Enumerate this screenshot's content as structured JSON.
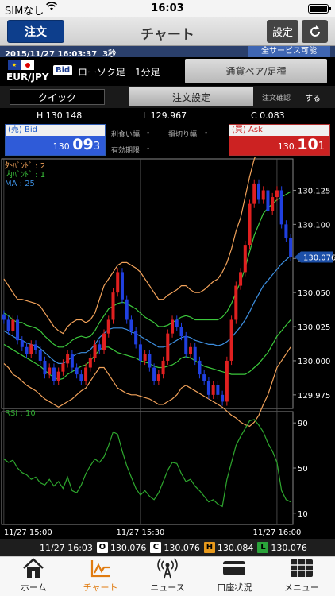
{
  "status_bar": {
    "carrier": "SIMなし",
    "time": "16:03"
  },
  "header": {
    "order_button": "注文",
    "title": "チャート",
    "settings_button": "設定",
    "refresh_icon": "refresh-icon"
  },
  "info_strip": {
    "timestamp": "2015/11/27 16:03:37",
    "age": "3秒",
    "service_status": "全サービス可能"
  },
  "pair": {
    "name": "EUR/JPY",
    "rate_type": "Bid",
    "chart_type": "ローソク足",
    "interval": "1分足",
    "pair_button": "通貨ペア/足種"
  },
  "quick_row": {
    "quick_button": "クイック",
    "order_settings_button": "注文設定",
    "confirm_label": "注文確認",
    "confirm_value": "する"
  },
  "hlc": {
    "high": "H  130.148",
    "low": "L  129.967",
    "change": "C  0.083"
  },
  "bid": {
    "label": "(売) Bid",
    "price_small": "130.",
    "price_big": "09",
    "price_tail": "3"
  },
  "ask": {
    "label": "(買) Ask",
    "price_small": "130.",
    "price_big": "10",
    "price_tail": "1"
  },
  "mid_fields": {
    "take_profit": "利食い幅",
    "stop_loss": "損切り幅",
    "expiry": "有効期限",
    "dash": "-"
  },
  "legend": {
    "outer_band": "外ﾊﾞﾝﾄﾞ : 2",
    "inner_band": "内ﾊﾞﾝﾄﾞ : 1",
    "ma": "MA : 25",
    "rsi": "RSI : 10"
  },
  "colors": {
    "outer_band": "#f2a25a",
    "inner_band": "#3cc83c",
    "ma": "#3d8fe0",
    "rsi": "#2ea82e",
    "bull": "#e02020",
    "bear": "#2040e0",
    "bid": "#2f5bd8",
    "ask": "#cc2222",
    "tab_active": "#e07b10"
  },
  "chart_data": [
    {
      "type": "candlestick",
      "title": "",
      "y_ticks": [
        "130.125",
        "130.100",
        "130.075",
        "130.050",
        "130.025",
        "130.000",
        "129.975"
      ],
      "current_price_label": "130.076",
      "current_price": 130.076,
      "ylim": [
        129.965,
        130.148
      ],
      "x_ticks": [
        "11/27 15:00",
        "11/27 15:30",
        "11/27 16:00"
      ],
      "x_tick_index": [
        0,
        30,
        60
      ],
      "bar_count": 64,
      "close": [
        130.03,
        130.022,
        130.03,
        130.015,
        130.01,
        130.005,
        130.012,
        130.008,
        130.0,
        129.99,
        129.995,
        129.985,
        129.992,
        129.998,
        130.005,
        129.995,
        129.99,
        129.985,
        129.995,
        130.002,
        130.012,
        130.008,
        130.02,
        130.03,
        130.05,
        130.065,
        130.045,
        130.03,
        130.022,
        130.012,
        130.0,
        130.005,
        129.995,
        129.985,
        129.99,
        130.0,
        130.02,
        130.03,
        130.025,
        130.018,
        130.005,
        130.01,
        130.0,
        129.99,
        129.985,
        129.975,
        129.982,
        129.975,
        129.97,
        130.0,
        130.03,
        130.055,
        130.065,
        130.085,
        130.115,
        130.13,
        130.118,
        130.125,
        130.11,
        130.12,
        130.125,
        130.1,
        130.09,
        130.076
      ],
      "series": [
        {
          "name": "外ﾊﾞﾝﾄﾞ : 2",
          "values": [
            130.06,
            130.055,
            130.05,
            130.045,
            130.045,
            130.044,
            130.043,
            130.042,
            130.04,
            130.035,
            130.03,
            130.025,
            130.022,
            130.02,
            130.025,
            130.028,
            130.03,
            130.03,
            130.028,
            130.03,
            130.035,
            130.045,
            130.055,
            130.06,
            130.065,
            130.07,
            130.072,
            130.072,
            130.07,
            130.068,
            130.065,
            130.06,
            130.055,
            130.05,
            130.045,
            130.045,
            130.048,
            130.05,
            130.052,
            130.055,
            130.055,
            130.052,
            130.05,
            130.05,
            130.052,
            130.055,
            130.058,
            130.06,
            130.065,
            130.072,
            130.082,
            130.095,
            130.105,
            130.12,
            130.135,
            130.148,
            130.155,
            130.16,
            130.165,
            130.165,
            130.165,
            130.162,
            130.16,
            130.16
          ]
        },
        {
          "name": "外ﾊﾞﾝﾄﾞ : 2 (lower)",
          "values": [
            129.998,
            129.995,
            129.99,
            129.988,
            129.985,
            129.982,
            129.98,
            129.978,
            129.975,
            129.972,
            129.97,
            129.968,
            129.966,
            129.968,
            129.97,
            129.972,
            129.975,
            129.978,
            129.98,
            129.985,
            129.99,
            129.995,
            129.995,
            129.99,
            129.985,
            129.98,
            129.978,
            129.976,
            129.975,
            129.975,
            129.974,
            129.973,
            129.972,
            129.97,
            129.968,
            129.968,
            129.97,
            129.972,
            129.975,
            129.98,
            129.982,
            129.98,
            129.978,
            129.976,
            129.974,
            129.972,
            129.97,
            129.968,
            129.966,
            129.963,
            129.96,
            129.958,
            129.955,
            129.953,
            129.952,
            129.955,
            129.96,
            129.968,
            129.975,
            129.985,
            129.995,
            130.0,
            130.005,
            130.01
          ]
        },
        {
          "name": "内ﾊﾞﾝﾄﾞ : 1",
          "values": [
            130.035,
            130.033,
            130.03,
            130.028,
            130.028,
            130.026,
            130.025,
            130.024,
            130.022,
            130.018,
            130.015,
            130.012,
            130.01,
            130.01,
            130.012,
            130.015,
            130.017,
            130.018,
            130.017,
            130.018,
            130.022,
            130.028,
            130.033,
            130.038,
            130.04,
            130.042,
            130.043,
            130.042,
            130.04,
            130.038,
            130.035,
            130.032,
            130.03,
            130.028,
            130.025,
            130.025,
            130.026,
            130.028,
            130.03,
            130.032,
            130.033,
            130.032,
            130.03,
            130.03,
            130.03,
            130.03,
            130.03,
            130.03,
            130.032,
            130.036,
            130.042,
            130.05,
            130.058,
            130.068,
            130.08,
            130.092,
            130.1,
            130.108,
            130.112,
            130.115,
            130.118,
            130.12,
            130.122,
            130.124
          ]
        },
        {
          "name": "内ﾊﾞﾝﾄﾞ : 1 (lower)",
          "values": [
            130.012,
            130.01,
            130.008,
            130.006,
            130.004,
            130.002,
            130.0,
            129.998,
            129.996,
            129.993,
            129.99,
            129.988,
            129.986,
            129.987,
            129.99,
            129.992,
            129.994,
            129.996,
            129.997,
            130.0,
            130.004,
            130.008,
            130.01,
            130.01,
            130.008,
            130.006,
            130.005,
            130.004,
            130.003,
            130.002,
            130.0,
            129.999,
            129.998,
            129.996,
            129.995,
            129.995,
            129.996,
            129.997,
            129.999,
            130.002,
            130.003,
            130.002,
            130.0,
            129.998,
            129.996,
            129.995,
            129.994,
            129.993,
            129.992,
            129.991,
            129.99,
            129.99,
            129.99,
            129.99,
            129.992,
            129.995,
            129.998,
            130.002,
            130.006,
            130.012,
            130.018,
            130.022,
            130.026,
            130.03
          ]
        },
        {
          "name": "MA : 25",
          "values": [
            130.022,
            130.02,
            130.018,
            130.016,
            130.015,
            130.013,
            130.012,
            130.011,
            130.009,
            130.006,
            130.003,
            130.0,
            129.998,
            129.998,
            130.0,
            130.003,
            130.005,
            130.006,
            130.006,
            130.008,
            130.012,
            130.017,
            130.02,
            130.023,
            130.024,
            130.024,
            130.024,
            130.023,
            130.021,
            130.02,
            130.018,
            130.016,
            130.014,
            130.012,
            130.01,
            130.01,
            130.011,
            130.013,
            130.015,
            130.017,
            130.018,
            130.017,
            130.015,
            130.014,
            130.013,
            130.012,
            130.012,
            130.011,
            130.012,
            130.014,
            130.017,
            130.021,
            130.025,
            130.03,
            130.036,
            130.043,
            130.049,
            130.055,
            130.059,
            130.063,
            130.067,
            130.071,
            130.074,
            130.077
          ]
        }
      ]
    },
    {
      "type": "line",
      "title": "",
      "y_ticks": [
        "90",
        "50",
        "10"
      ],
      "ylim": [
        0,
        100
      ],
      "series": [
        {
          "name": "RSI : 10",
          "values": [
            58,
            55,
            57,
            50,
            46,
            44,
            40,
            42,
            37,
            35,
            40,
            34,
            38,
            32,
            42,
            30,
            28,
            35,
            45,
            52,
            58,
            55,
            60,
            70,
            82,
            80,
            65,
            52,
            42,
            32,
            26,
            30,
            25,
            22,
            28,
            38,
            48,
            55,
            54,
            45,
            38,
            40,
            34,
            30,
            25,
            20,
            22,
            18,
            16,
            40,
            55,
            70,
            78,
            85,
            92,
            93,
            88,
            82,
            72,
            65,
            55,
            30,
            22,
            20
          ]
        }
      ]
    }
  ],
  "quote_bar": {
    "time": "11/27 16:03",
    "o_tag": "O",
    "open": "130.076",
    "c_tag": "C",
    "close": "130.076",
    "h_tag": "H",
    "high": "130.084",
    "l_tag": "L",
    "low": "130.076"
  },
  "tabs": [
    {
      "label": "ホーム",
      "icon": "home-icon"
    },
    {
      "label": "チャート",
      "icon": "chart-icon"
    },
    {
      "label": "ニュース",
      "icon": "news-icon"
    },
    {
      "label": "口座状況",
      "icon": "account-icon"
    },
    {
      "label": "メニュー",
      "icon": "menu-icon"
    }
  ]
}
